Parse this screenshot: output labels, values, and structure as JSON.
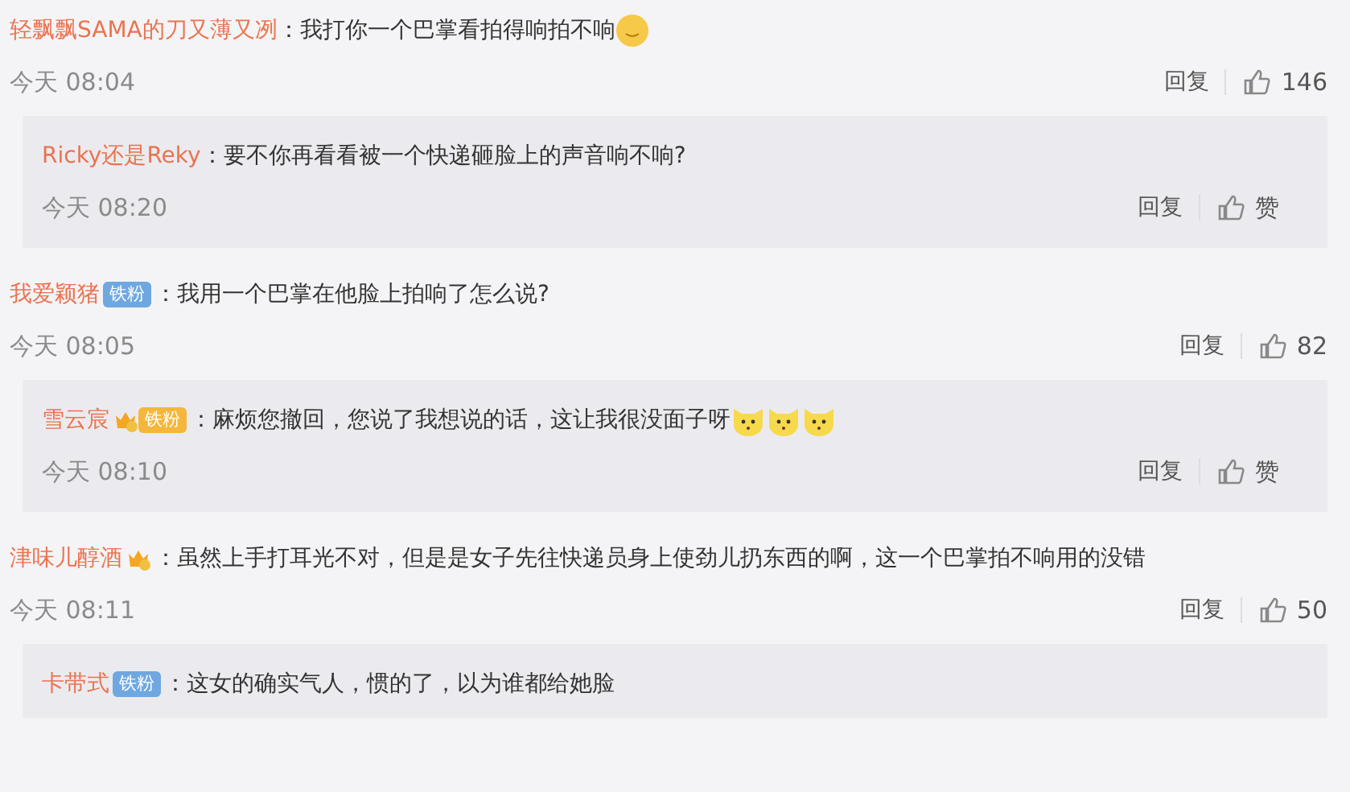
{
  "comments": [
    {
      "user": "轻飘飘SAMA的刀又薄又冽",
      "text": "：我打你一个巴掌看拍得响拍不响",
      "emojis": [
        {
          "kind": "smile"
        }
      ],
      "time": "今天 08:04",
      "reply_label": "回复",
      "likes": "146",
      "replies": [
        {
          "user": "Ricky还是Reky",
          "text": "：要不你再看看被一个快递砸脸上的声音响不响?",
          "time": "今天 08:20",
          "reply_label": "回复",
          "likes": "赞"
        }
      ]
    },
    {
      "user": "我爱颖猪",
      "badge": {
        "kind": "fan",
        "label": "铁粉"
      },
      "text": "：我用一个巴掌在他脸上拍响了怎么说?",
      "time": "今天 08:05",
      "reply_label": "回复",
      "likes": "82",
      "replies": [
        {
          "user": "雪云宸",
          "badge": {
            "kind": "crown_fan",
            "label": "铁粉"
          },
          "text": "：麻烦您撤回，您说了我想说的话，这让我很没面子呀",
          "emojis": [
            {
              "kind": "cat"
            },
            {
              "kind": "cat"
            },
            {
              "kind": "cat"
            }
          ],
          "time": "今天 08:10",
          "reply_label": "回复",
          "likes": "赞"
        }
      ]
    },
    {
      "user": "津味儿醇酒",
      "badge": {
        "kind": "crown"
      },
      "text": "：虽然上手打耳光不对，但是是女子先往快递员身上使劲儿扔东西的啊，这一个巴掌拍不响用的没错",
      "time": "今天 08:11",
      "reply_label": "回复",
      "likes": "50",
      "replies": [
        {
          "user": "卡带式",
          "badge": {
            "kind": "fan",
            "label": "铁粉"
          },
          "text": "：这女的确实气人，惯的了，以为谁都给她脸"
        }
      ]
    }
  ]
}
